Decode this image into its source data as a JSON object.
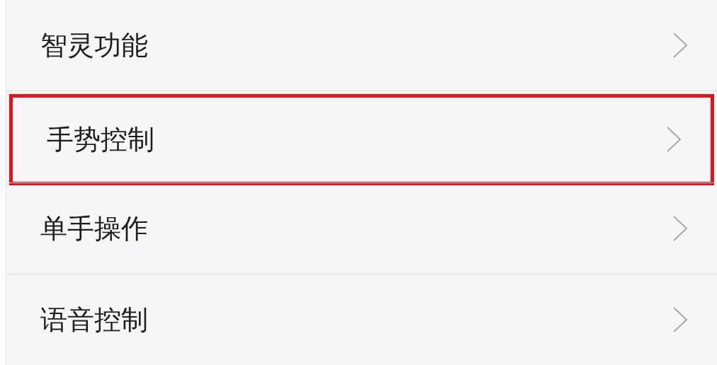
{
  "settings_list": [
    {
      "label": "智灵功能",
      "highlighted": false
    },
    {
      "label": "手势控制",
      "highlighted": true
    },
    {
      "label": "单手操作",
      "highlighted": false
    },
    {
      "label": "语音控制",
      "highlighted": false
    }
  ]
}
